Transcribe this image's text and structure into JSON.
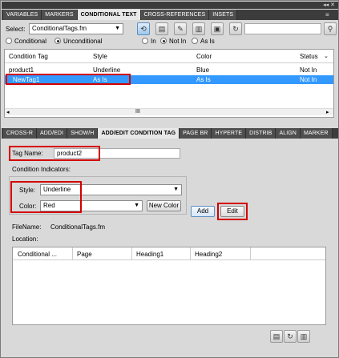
{
  "window": {
    "controls": "◂◂ ✕",
    "menu": "≡"
  },
  "top_tabs": [
    "VARIABLES",
    "MARKERS",
    "CONDITIONAL TEXT",
    "CROSS-REFERENCES",
    "INSETS"
  ],
  "select_label": "Select:",
  "select_value": "ConditionalTags.fm",
  "radios_left": [
    "Conditional",
    "Unconditional"
  ],
  "radios_right": [
    "In",
    "Not In",
    "As Is"
  ],
  "table": {
    "headers": [
      "Condition Tag",
      "Style",
      "Color",
      "Status"
    ],
    "rows": [
      [
        "product1",
        "Underline",
        "Blue",
        "Not In"
      ],
      [
        "NewTag1",
        "As Is",
        "As Is",
        "Not In"
      ]
    ],
    "scroll_thumb": "III"
  },
  "bottom_tabs": [
    "CROSS-R",
    "ADD/EDI",
    "SHOW/H",
    "ADD/EDIT CONDITION TAG",
    "PAGE BR",
    "HYPERTE",
    "DISTRIB",
    "ALIGN",
    "MARKER"
  ],
  "form": {
    "tag_name_label": "Tag Name:",
    "tag_name_value": "product2",
    "indicators_label": "Condition Indicators:",
    "style_label": "Style:",
    "style_value": "Underline",
    "color_label": "Color:",
    "color_value": "Red",
    "new_color": "New Color",
    "add": "Add",
    "edit": "Edit",
    "filename_label": "FileName:",
    "filename_value": "ConditionalTags.fm",
    "location_label": "Location:"
  },
  "location_table": {
    "headers": [
      "Conditional ...",
      "Page",
      "Heading1",
      "Heading2"
    ]
  }
}
